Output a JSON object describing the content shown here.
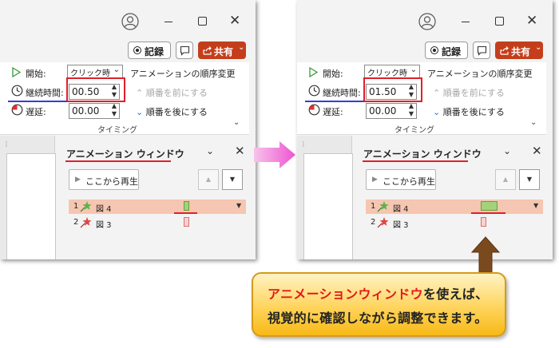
{
  "panels": [
    {
      "record_label": "記録",
      "share_label": "共有",
      "start": {
        "label": "開始:",
        "value": "クリック時"
      },
      "duration": {
        "label": "継続時間:",
        "value": "00.50"
      },
      "delay": {
        "label": "遅延:",
        "value": "00.00"
      },
      "reorder": {
        "title": "アニメーションの順序変更",
        "earlier": "順番を前にする",
        "later": "順番を後にする"
      },
      "group_label": "タイミング",
      "pane": {
        "title": "アニメーション ウィンドウ",
        "play_from": "ここから再生",
        "items": [
          {
            "num": "1",
            "name": "図 4",
            "duration": 0.5,
            "selected": true
          },
          {
            "num": "2",
            "name": "図 3",
            "duration": 0.5,
            "selected": false
          }
        ]
      }
    },
    {
      "record_label": "記録",
      "share_label": "共有",
      "start": {
        "label": "開始:",
        "value": "クリック時"
      },
      "duration": {
        "label": "継続時間:",
        "value": "01.50"
      },
      "delay": {
        "label": "遅延:",
        "value": "00.00"
      },
      "reorder": {
        "title": "アニメーションの順序変更",
        "earlier": "順番を前にする",
        "later": "順番を後にする"
      },
      "group_label": "タイミング",
      "pane": {
        "title": "アニメーション ウィンドウ",
        "play_from": "ここから再生",
        "items": [
          {
            "num": "1",
            "name": "図 4",
            "duration": 1.5,
            "selected": true
          },
          {
            "num": "2",
            "name": "図 3",
            "duration": 0.5,
            "selected": false
          }
        ]
      }
    }
  ],
  "callout": {
    "highlight": "アニメーションウィンドウ",
    "line1_rest": "を使えば、",
    "line2": "視覚的に確認しながら調整できます。"
  },
  "colors": {
    "accent_red": "#e21b1b",
    "share_button": "#c43e1c",
    "selection_row": "#f5c6b1",
    "bar_green": "#a3d27a",
    "callout_gold": "#ffd45c",
    "arrow_magenta": "#ee55d0"
  },
  "icons": [
    "user-avatar-icon",
    "record-icon",
    "comment-icon",
    "share-icon",
    "play-icon",
    "clock-icon",
    "delay-icon",
    "chevron-up-icon",
    "chevron-down-icon",
    "close-icon",
    "animation-star-icon"
  ]
}
